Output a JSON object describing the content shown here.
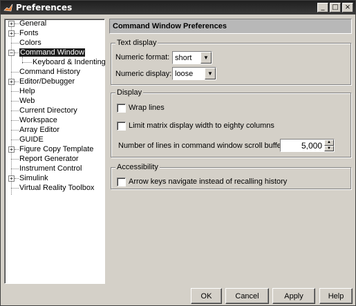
{
  "window": {
    "title": "Preferences",
    "controls": {
      "minimize": "_",
      "maximize": "□",
      "close": "×"
    }
  },
  "tree": {
    "items": [
      {
        "label": "General",
        "expander": "+"
      },
      {
        "label": "Fonts",
        "expander": "+"
      },
      {
        "label": "Colors"
      },
      {
        "label": "Command Window",
        "expander": "−",
        "selected": true
      },
      {
        "label": "Keyboard & Indenting"
      },
      {
        "label": "Command History"
      },
      {
        "label": "Editor/Debugger",
        "expander": "+"
      },
      {
        "label": "Help"
      },
      {
        "label": "Web"
      },
      {
        "label": "Current Directory"
      },
      {
        "label": "Workspace"
      },
      {
        "label": "Array Editor"
      },
      {
        "label": "GUIDE"
      },
      {
        "label": "Figure Copy Template",
        "expander": "+"
      },
      {
        "label": "Report Generator"
      },
      {
        "label": "Instrument Control"
      },
      {
        "label": "Simulink",
        "expander": "+"
      },
      {
        "label": "Virtual Reality Toolbox"
      }
    ]
  },
  "panel": {
    "header": "Command Window Preferences",
    "text_display": {
      "legend": "Text display",
      "numeric_format_label": "Numeric format:",
      "numeric_format_value": "short",
      "numeric_display_label": "Numeric display:",
      "numeric_display_value": "loose"
    },
    "display": {
      "legend": "Display",
      "wrap_lines_label": "Wrap lines",
      "wrap_lines_checked": false,
      "limit_width_label": "Limit matrix display width to eighty columns",
      "limit_width_checked": false,
      "scroll_buffer_label": "Number of lines in command window scroll buffer:",
      "scroll_buffer_value": "5,000"
    },
    "accessibility": {
      "legend": "Accessibility",
      "arrow_keys_label": "Arrow keys navigate instead of recalling history",
      "arrow_keys_checked": false
    }
  },
  "buttons": {
    "ok": "OK",
    "cancel": "Cancel",
    "apply": "Apply",
    "help": "Help"
  }
}
